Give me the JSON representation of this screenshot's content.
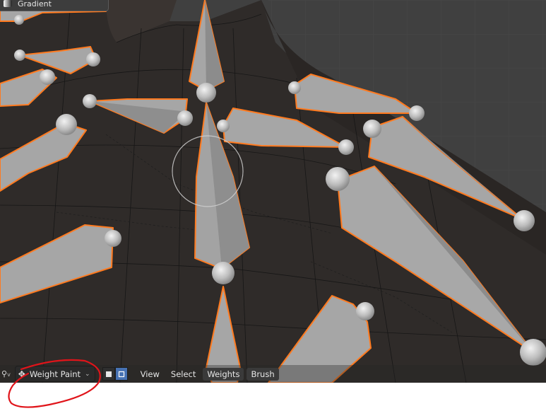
{
  "gradient_panel": {
    "label": "Gradient"
  },
  "header": {
    "mode_label": "Weight Paint",
    "menus": [
      "View",
      "Select",
      "Weights",
      "Brush"
    ]
  },
  "colors": {
    "bone_fill": "#9e9e9e",
    "bone_outline": "#ff7a1f",
    "mesh": "#2f2b29",
    "viewport_bg": "#3f3f3f",
    "annotation": "#e0141a",
    "xray_active": "#4772b3"
  },
  "icons": [
    "viewport-shading-icon",
    "weight-paint-mode-icon",
    "chevron-down-icon",
    "xray-toggle-icon"
  ]
}
